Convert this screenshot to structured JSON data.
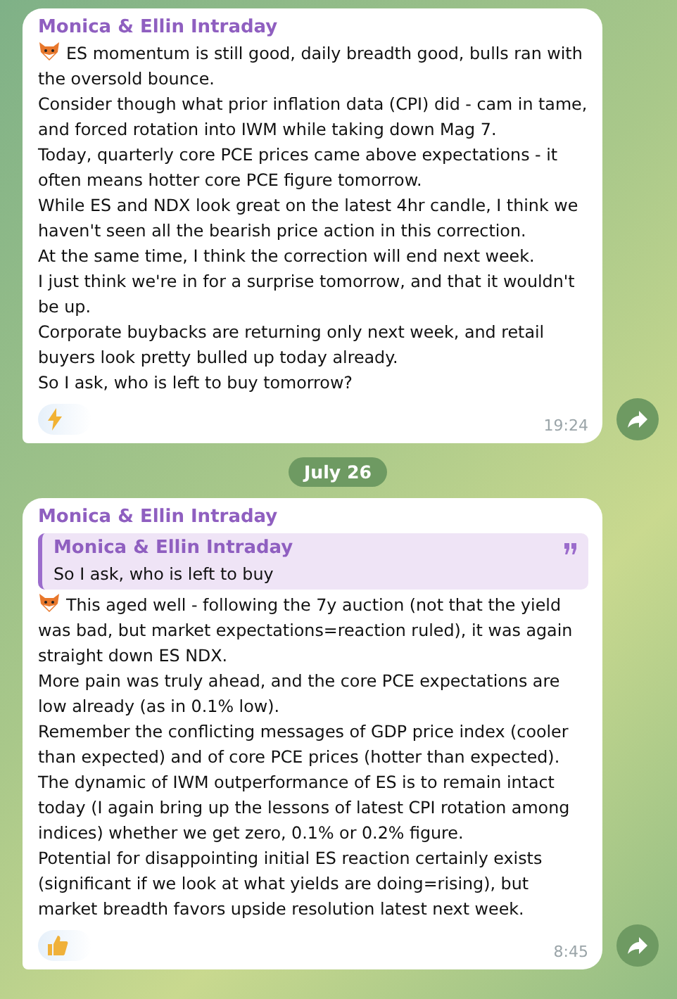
{
  "messages": [
    {
      "sender": "Monica & Ellin Intraday",
      "lead_icon": {
        "kind": "fox"
      },
      "paragraphs": [
        "ES momentum is still good, daily breadth good, bulls ran with the oversold bounce.",
        "Consider though what prior inflation data (CPI) did - cam in tame, and forced rotation into IWM while taking down Mag 7.",
        "Today, quarterly core PCE prices came above expectations - it often means hotter core PCE figure tomorrow.",
        "While ES and NDX look great on the latest 4hr candle, I think we haven't seen all the bearish price action in this correction.",
        "At the same time, I think the correction will end next week.",
        "I just think we're in for a surprise tomorrow, and that it wouldn't be up.",
        "Corporate buybacks are returning only next week, and retail buyers look pretty bulled up today already.",
        "So I ask, who is left to buy tomorrow?"
      ],
      "reaction": {
        "kind": "lightning"
      },
      "time": "19:24"
    },
    {
      "date_separator": "July 26",
      "sender": "Monica & Ellin Intraday",
      "quote": {
        "sender": "Monica & Ellin Intraday",
        "text": "So I ask, who is left to buy"
      },
      "lead_icon": {
        "kind": "fox"
      },
      "paragraphs": [
        "This aged well - following the 7y auction (not that the yield was bad, but market expectations=reaction ruled), it was again straight down ES NDX.",
        "More pain was truly ahead, and the core PCE expectations are low already (as in 0.1% low).",
        "Remember the conflicting messages of GDP price index (cooler than expected) and of core PCE prices (hotter than expected).",
        "The dynamic of IWM outperformance of ES is to remain intact today (I again bring up the lessons of latest CPI rotation among indices) whether we get zero, 0.1% or 0.2% figure.",
        "Potential for disappointing initial ES reaction certainly exists (significant if we look at what yields are doing=rising), but market breadth favors upside resolution latest next week."
      ],
      "reaction": {
        "kind": "thumbs-up"
      },
      "time": "8:45"
    }
  ]
}
